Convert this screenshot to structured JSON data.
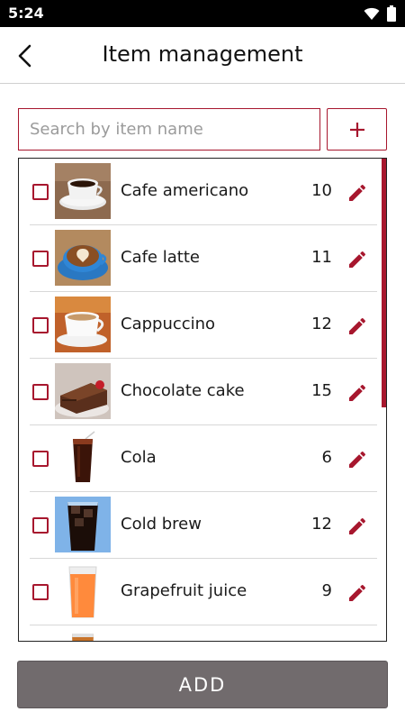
{
  "status_bar": {
    "time": "5:24"
  },
  "header": {
    "title": "Item management"
  },
  "search": {
    "placeholder": "Search by item name"
  },
  "items": [
    {
      "name": "Cafe americano",
      "qty": "10",
      "image": "americano-cup"
    },
    {
      "name": "Cafe latte",
      "qty": "11",
      "image": "latte-art-cup"
    },
    {
      "name": "Cappuccino",
      "qty": "12",
      "image": "cappuccino-cup"
    },
    {
      "name": "Chocolate cake",
      "qty": "15",
      "image": "chocolate-cake-slice"
    },
    {
      "name": "Cola",
      "qty": "6",
      "image": "cola-glass"
    },
    {
      "name": "Cold brew",
      "qty": "12",
      "image": "cold-brew-glass"
    },
    {
      "name": "Grapefruit juice",
      "qty": "9",
      "image": "grapefruit-juice-glass"
    },
    {
      "name": "",
      "qty": "",
      "image": "iced-drink-glass"
    }
  ],
  "footer": {
    "add_label": "ADD"
  },
  "colors": {
    "accent": "#a7172e",
    "add_button_bg": "#716b6d"
  }
}
